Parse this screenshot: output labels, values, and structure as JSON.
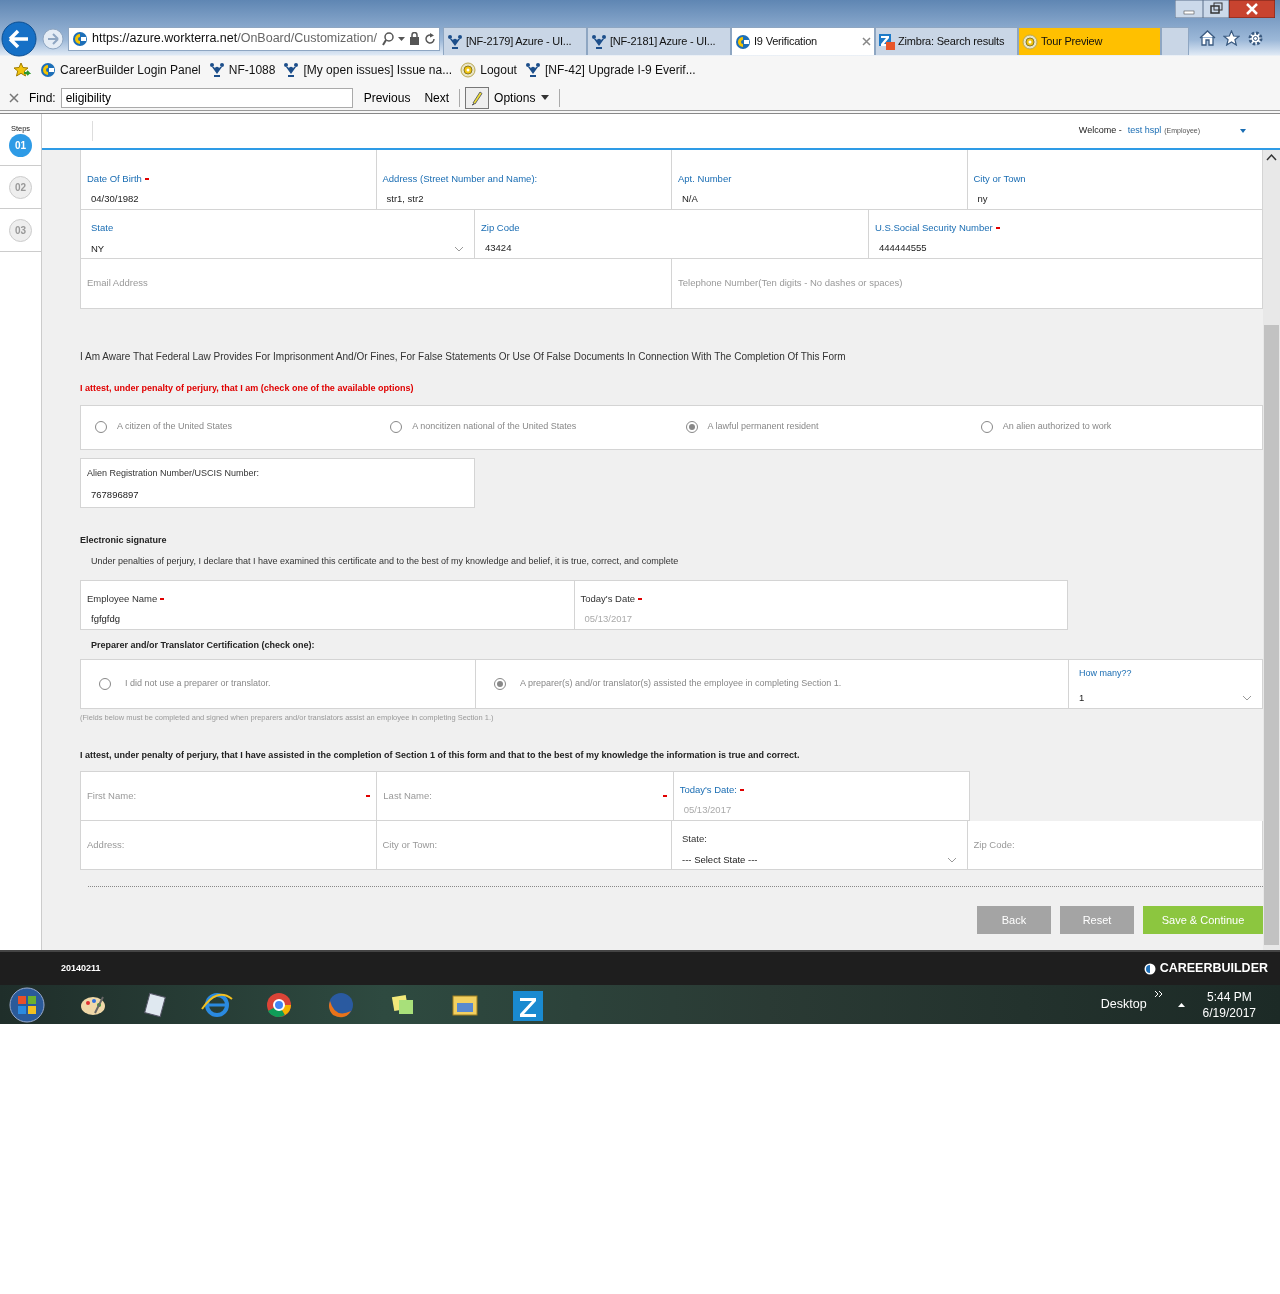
{
  "browser": {
    "address": {
      "prefix": "https://azure.",
      "domain": "workterra.net",
      "path": "/OnBoard/Customization/"
    },
    "tabs": [
      {
        "label": "[NF-2179] Azure - UI...",
        "kind": "jira",
        "selected": false
      },
      {
        "label": "[NF-2181] Azure - UI...",
        "kind": "jira",
        "selected": false
      },
      {
        "label": "I9 Verification",
        "kind": "cb",
        "selected": true
      },
      {
        "label": "Zimbra: Search results",
        "kind": "zimbra",
        "selected": false
      },
      {
        "label": "Tour Preview",
        "kind": "tour",
        "selected": false,
        "color": "#ffc000"
      }
    ],
    "favorites": [
      {
        "label": "CareerBuilder Login Panel",
        "kind": "cb"
      },
      {
        "label": "NF-1088",
        "kind": "jira"
      },
      {
        "label": "[My open issues] Issue na...",
        "kind": "jira"
      },
      {
        "label": "Logout",
        "kind": "tour"
      },
      {
        "label": "[NF-42] Upgrade I-9 Everif...",
        "kind": "jira"
      }
    ],
    "find": {
      "label": "Find:",
      "value": "eligibility",
      "previous": "Previous",
      "next": "Next",
      "options": "Options"
    }
  },
  "steps": {
    "title": "Steps",
    "items": [
      {
        "label": "01",
        "selected": true
      },
      {
        "label": "02",
        "selected": false
      },
      {
        "label": "03",
        "selected": false
      }
    ]
  },
  "header": {
    "welcome": "Welcome -",
    "user": "test hspl",
    "role": "(Employee)"
  },
  "personal": {
    "rows": [
      [
        {
          "kind": "text",
          "label": "Date Of Birth",
          "required": true,
          "value": "04/30/1982"
        },
        {
          "kind": "text",
          "label": "Address (Street Number and Name):",
          "value": "str1, str2"
        },
        {
          "kind": "text",
          "label": "Apt. Number",
          "value": "N/A"
        },
        {
          "kind": "text",
          "label": "City or Town",
          "value": "ny"
        }
      ],
      [
        {
          "kind": "select",
          "label": "State",
          "value": "NY"
        },
        {
          "kind": "text",
          "label": "Zip Code",
          "value": "43424"
        },
        {
          "kind": "text",
          "label": "U.S.Social Security Number",
          "required": true,
          "value": "444444555"
        }
      ],
      [
        {
          "kind": "placeholder",
          "placeholder": "Email Address"
        },
        {
          "kind": "placeholder",
          "placeholder": "Telephone Number(Ten digits - No dashes or spaces)"
        }
      ]
    ]
  },
  "notice": "I Am Aware That Federal Law Provides For Imprisonment And/Or Fines, For False Statements Or Use Of False Documents In Connection With The Completion Of This Form",
  "attest": "I attest, under penalty of perjury, that I am (check one of the available options)",
  "citizenship": [
    {
      "label": "A citizen of the United States",
      "selected": false
    },
    {
      "label": "A noncitizen national of the United States",
      "selected": false
    },
    {
      "label": "A lawful permanent resident",
      "selected": true
    },
    {
      "label": "An alien authorized to work",
      "selected": false
    }
  ],
  "alien": {
    "label": "Alien Registration Number/USCIS Number:",
    "value": "767896897"
  },
  "signature": {
    "title": "Electronic signature",
    "statement": "Under penalties of perjury, I declare that I have examined this certificate and to the best of my knowledge and belief, it is true, correct, and complete",
    "fields": [
      {
        "kind": "text",
        "label": "Employee Name",
        "required": true,
        "value": "fgfgfdg"
      },
      {
        "kind": "date",
        "label": "Today's Date",
        "required": true,
        "value": "05/13/2017"
      }
    ]
  },
  "preparer": {
    "title": "Preparer and/or Translator Certification (check one):",
    "options": [
      {
        "label": "I did not use a preparer or translator.",
        "selected": false
      },
      {
        "label": "A preparer(s) and/or translator(s) assisted the employee in completing Section 1.",
        "selected": true
      }
    ],
    "how_many": {
      "label": "How many??",
      "value": "1"
    },
    "note": "(Fields below must be completed and signed when preparers and/or translators assist an employee in completing Section 1.)",
    "attest": "I attest, under penalty of perjury, that I have assisted in the completion of Section 1 of this form and that to the best of my knowledge the information is true and correct.",
    "rows": [
      [
        {
          "kind": "placeholder",
          "placeholder": "First Name:",
          "required": true
        },
        {
          "kind": "placeholder",
          "placeholder": "Last Name:",
          "required": true
        },
        {
          "kind": "date",
          "label": "Today's Date:",
          "required": true,
          "value": "05/13/2017"
        }
      ],
      [
        {
          "kind": "placeholder",
          "placeholder": "Address:"
        },
        {
          "kind": "placeholder",
          "placeholder": "City or Town:"
        },
        {
          "kind": "select",
          "label": "State:",
          "value": "--- Select State ---"
        },
        {
          "kind": "placeholder",
          "placeholder": "Zip Code:"
        }
      ]
    ]
  },
  "buttons": [
    {
      "label": "Back",
      "kind": "secondary"
    },
    {
      "label": "Reset",
      "kind": "secondary"
    },
    {
      "label": "Save & Continue",
      "kind": "primary"
    }
  ],
  "footer": {
    "version": "20140211",
    "brand": "CAREERBUILDER"
  },
  "taskbar": {
    "desktop": "Desktop",
    "time": "5:44 PM",
    "date": "6/19/2017"
  }
}
